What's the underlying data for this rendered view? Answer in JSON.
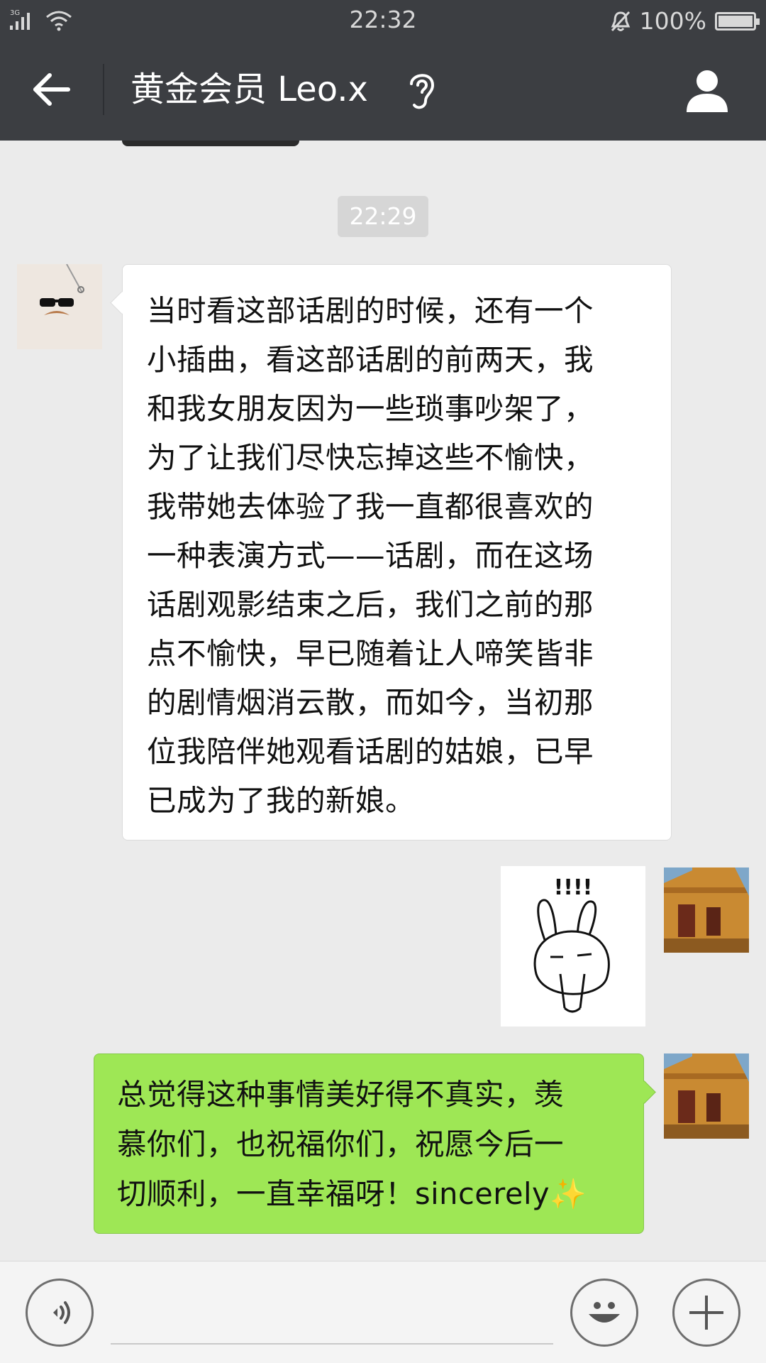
{
  "status_bar": {
    "network": "3G",
    "time": "22:32",
    "battery": "100%",
    "battery_level": 1.0
  },
  "header": {
    "title": "黄金会员 Leo.x",
    "back_icon": "arrow-left-icon",
    "mode_icon": "ear-icon",
    "profile_icon": "person-icon"
  },
  "chat": {
    "timestamp": "22:29",
    "messages": [
      {
        "direction": "incoming",
        "lines": [
          "当时看这部话剧的时候，还有一个",
          "小插曲，看这部话剧的前两天，我",
          "和我女朋友因为一些琐事吵架了，",
          "为了让我们尽快忘掉这些不愉快，",
          "我带她去体验了我一直都很喜欢的",
          "一种表演方式——话剧，而在这场",
          "话剧观影结束之后，我们之前的那",
          "点不愉快，早已随着让人啼笑皆非",
          "的剧情烟消云散，而如今，当初那",
          "位我陪伴她观看话剧的姑娘，已早",
          "已成为了我的新娘。"
        ]
      },
      {
        "direction": "outgoing",
        "type": "sticker",
        "sticker_text": "!!!!"
      },
      {
        "direction": "outgoing",
        "lines": [
          "总觉得这种事情美好得不真实，羡",
          "慕你们，也祝福你们，祝愿今后一",
          "切顺利，一直幸福呀！sincerely"
        ],
        "emoji": "✨"
      }
    ]
  },
  "input_bar": {
    "voice_icon": "voice-icon",
    "emoji_icon": "smiley-icon",
    "plus_icon": "plus-icon"
  },
  "colors": {
    "header_bg": "#3c3e42",
    "chat_bg": "#ebebeb",
    "outgoing_bubble": "#9ee755",
    "incoming_bubble": "#ffffff"
  }
}
